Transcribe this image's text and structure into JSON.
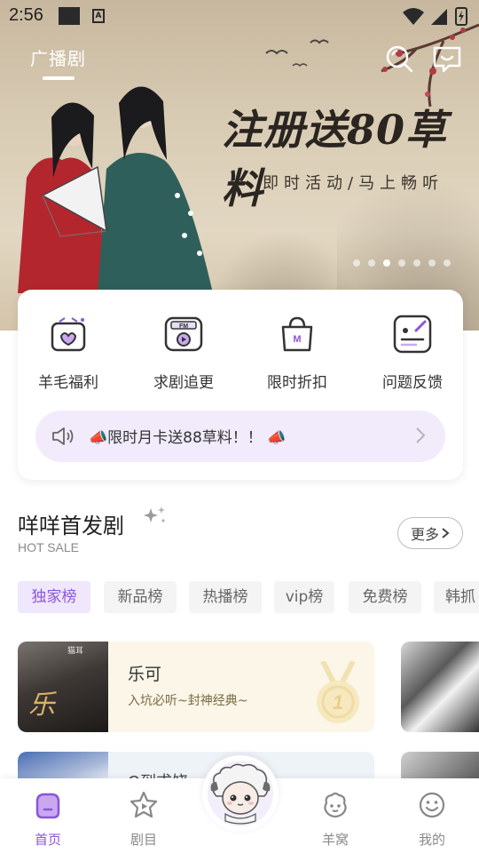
{
  "status_bar": {
    "time": "2:56",
    "icons": [
      "notification-square-icon",
      "a-badge-icon",
      "wifi-icon",
      "signal-icon",
      "battery-icon"
    ],
    "badge_letter": "A"
  },
  "header": {
    "tab_label": "广播剧",
    "search_icon": "search-icon",
    "message_icon": "message-icon"
  },
  "banner": {
    "title": "注册送80草料",
    "subtitle": "即时活动/马上畅听",
    "dot_count": 7,
    "active_dot": 1
  },
  "quick_menu": {
    "items": [
      {
        "label": "羊毛福利",
        "icon": "gift-box-icon"
      },
      {
        "label": "求剧追更",
        "icon": "fm-radio-icon"
      },
      {
        "label": "限时折扣",
        "icon": "discount-bag-icon"
      },
      {
        "label": "问题反馈",
        "icon": "feedback-icon"
      }
    ],
    "announcement": "📣限时月卡送88草料！！ 📣"
  },
  "hot_section": {
    "title": "咩咩首发剧",
    "subtitle": "HOT SALE",
    "more_label": "更多"
  },
  "rank_tabs": [
    {
      "label": "独家榜",
      "active": true
    },
    {
      "label": "新品榜",
      "active": false
    },
    {
      "label": "热播榜",
      "active": false
    },
    {
      "label": "vip榜",
      "active": false
    },
    {
      "label": "免费榜",
      "active": false
    },
    {
      "label": "韩抓",
      "active": false
    }
  ],
  "rank_cards": [
    {
      "title": "乐可",
      "desc": "入坑必听~封神经典~",
      "cover_text": "乐",
      "cover_badge": "猫耳",
      "rank": "1"
    },
    {
      "title": "Q到求饶"
    }
  ],
  "bottom_nav": {
    "items": [
      {
        "label": "首页",
        "icon": "home-icon",
        "active": true
      },
      {
        "label": "剧目",
        "icon": "play-star-icon",
        "active": false
      },
      {
        "label": "",
        "icon": "sheep-mascot-icon",
        "active": false
      },
      {
        "label": "羊窝",
        "icon": "sheep-head-icon",
        "active": false
      },
      {
        "label": "我的",
        "icon": "smile-face-icon",
        "active": false
      }
    ]
  },
  "colors": {
    "accent": "#8a56d8",
    "accent_light": "#efe7fb",
    "announce_bg": "#f1ebfb",
    "card_bg": "#fbf6e7"
  }
}
